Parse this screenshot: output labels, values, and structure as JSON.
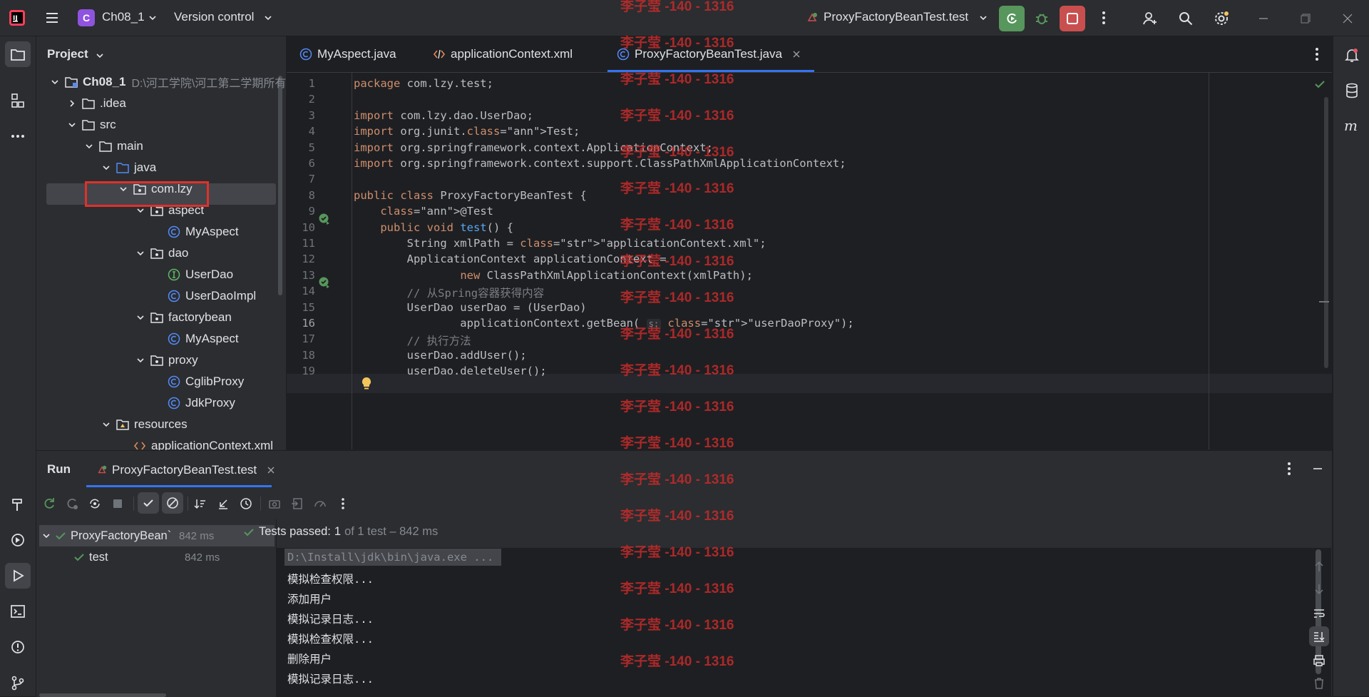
{
  "titlebar": {
    "project_badge": "C",
    "project_name": "Ch08_1",
    "vcs": "Version control",
    "run_config": "ProxyFactoryBeanTest.test"
  },
  "project_panel": {
    "title": "Project",
    "tree": [
      {
        "label": "Ch08_1",
        "note": "D:\\河工学院\\河工第二学期所有",
        "icon": "module-folder-icon",
        "expanded": true
      },
      {
        "label": ".idea",
        "icon": "folder-icon",
        "expanded": false
      },
      {
        "label": "src",
        "icon": "folder-icon",
        "expanded": true
      },
      {
        "label": "main",
        "icon": "folder-icon",
        "expanded": true
      },
      {
        "label": "java",
        "icon": "source-folder-icon",
        "expanded": true
      },
      {
        "label": "com.lzy",
        "icon": "package-icon",
        "expanded": true
      },
      {
        "label": "aspect",
        "icon": "package-icon",
        "expanded": true
      },
      {
        "label": "MyAspect",
        "icon": "class-icon"
      },
      {
        "label": "dao",
        "icon": "package-icon",
        "expanded": true
      },
      {
        "label": "UserDao",
        "icon": "interface-icon"
      },
      {
        "label": "UserDaoImpl",
        "icon": "class-icon"
      },
      {
        "label": "factorybean",
        "icon": "package-icon",
        "expanded": true
      },
      {
        "label": "MyAspect",
        "icon": "class-icon"
      },
      {
        "label": "proxy",
        "icon": "package-icon",
        "expanded": true
      },
      {
        "label": "CglibProxy",
        "icon": "class-icon"
      },
      {
        "label": "JdkProxy",
        "icon": "class-icon"
      },
      {
        "label": "resources",
        "icon": "resources-folder-icon",
        "expanded": true
      },
      {
        "label": "applicationContext.xml",
        "icon": "xml-icon"
      }
    ]
  },
  "editor": {
    "tabs": [
      {
        "label": "MyAspect.java",
        "icon": "class-icon"
      },
      {
        "label": "applicationContext.xml",
        "icon": "xml-icon"
      },
      {
        "label": "ProxyFactoryBeanTest.java",
        "icon": "class-icon",
        "active": true
      }
    ],
    "line_numbers": [
      "1",
      "2",
      "3",
      "4",
      "5",
      "6",
      "7",
      "8",
      "9",
      "10",
      "11",
      "12",
      "13",
      "14",
      "15",
      "16",
      "17",
      "18",
      "19"
    ],
    "lines": [
      "package com.lzy.test;",
      "",
      "import com.lzy.dao.UserDao;",
      "import org.junit.Test;",
      "import org.springframework.context.ApplicationContext;",
      "import org.springframework.context.support.ClassPathXmlApplicationContext;",
      "",
      "public class ProxyFactoryBeanTest {",
      "    @Test",
      "    public void test() {",
      "        String xmlPath = \"applicationContext.xml\";",
      "        ApplicationContext applicationContext =",
      "                new ClassPathXmlApplicationContext(xmlPath);",
      "        // 从Spring容器获得内容",
      "        UserDao userDao = (UserDao)",
      "                applicationContext.getBean( s: \"userDaoProxy\");",
      "        // 执行方法",
      "        userDao.addUser();",
      "        userDao.deleteUser();"
    ],
    "param_hint": "s:"
  },
  "run_panel": {
    "title": "Run",
    "tab": "ProxyFactoryBeanTest.test",
    "status_prefix": "Tests passed:",
    "status_count": "1",
    "status_suffix": "of 1 test – 842 ms",
    "results": [
      {
        "label": "ProxyFactoryBean`",
        "time": "842 ms"
      },
      {
        "label": "test",
        "time": "842 ms"
      }
    ],
    "console": [
      "D:\\Install\\jdk\\bin\\java.exe ...",
      "模拟检查权限...",
      "添加用户",
      "模拟记录日志...",
      "模拟检查权限...",
      "删除用户",
      "模拟记录日志..."
    ]
  },
  "watermark": "李子莹 -140 - 1316",
  "colors": {
    "accent": "#3574f0",
    "run_green": "#57965c",
    "stop_red": "#c94f4f",
    "highlight_box": "#e0312b",
    "badge_purple": "#8f53e0"
  }
}
